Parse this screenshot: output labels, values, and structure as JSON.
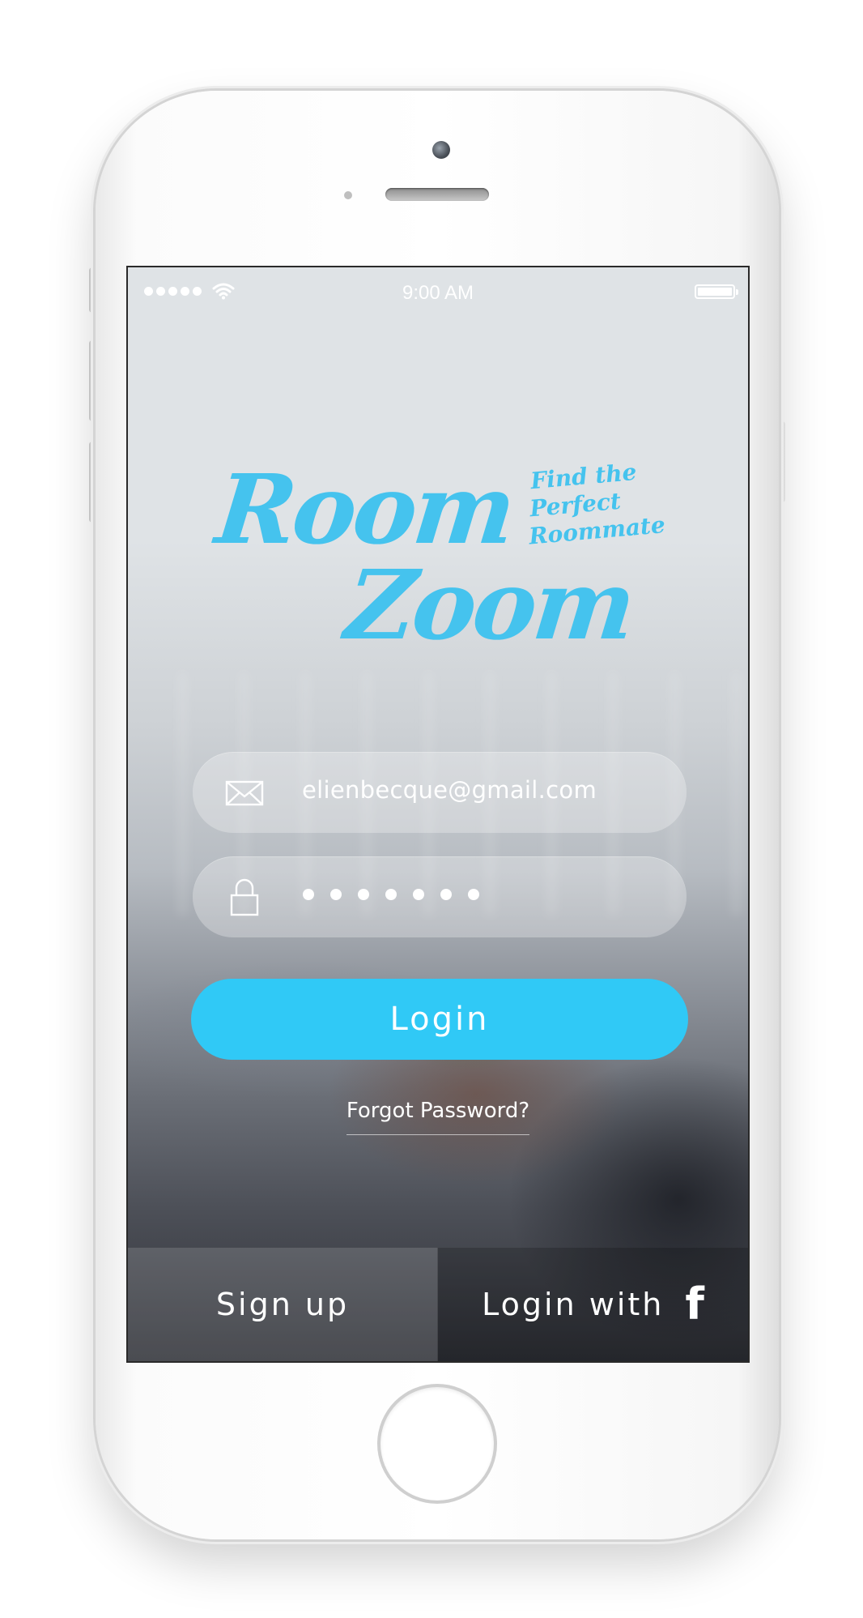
{
  "status_bar": {
    "time": "9:00 AM",
    "signal_icon": "signal-dots-icon",
    "wifi_icon": "wifi-icon",
    "battery_icon": "battery-icon"
  },
  "logo": {
    "line1": "Room",
    "line2": "Zoom",
    "tagline": [
      "Find the",
      "Perfect",
      "Roommate"
    ],
    "color": "#45c3ee"
  },
  "login_form": {
    "email": {
      "icon": "envelope-icon",
      "value": "elienbecque@gmail.com"
    },
    "password": {
      "icon": "lock-icon",
      "masked_length": 7
    },
    "login_label": "Login",
    "forgot_label": "Forgot Password?",
    "accent_color": "#30c9f6"
  },
  "bottom_bar": {
    "signup_label": "Sign up",
    "facebook_label": "Login with",
    "facebook_icon": "facebook-icon"
  }
}
